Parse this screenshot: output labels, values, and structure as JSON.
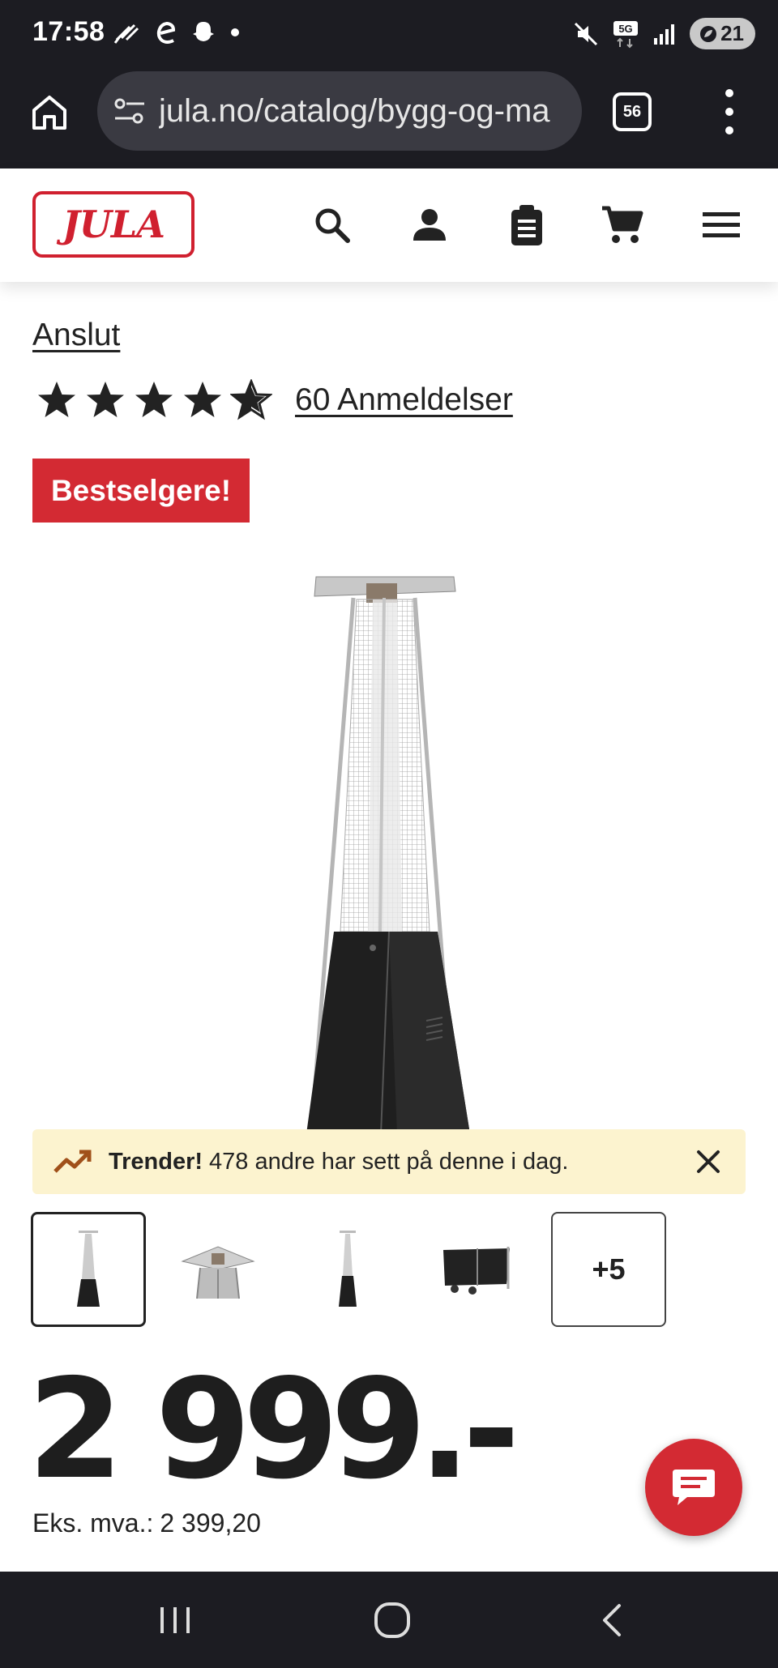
{
  "status_bar": {
    "time": "17:58",
    "left_icons": [
      "feather-icon",
      "e-icon",
      "snapchat-ghost-icon",
      "dot-icon"
    ],
    "network": "5G",
    "battery": "21",
    "right_icons": [
      "mute-icon",
      "5g-icon",
      "signal-icon",
      "battery-icon"
    ]
  },
  "browser": {
    "url": "jula.no/catalog/bygg-og-ma",
    "tab_count": "56",
    "icons": [
      "home-icon",
      "tune-icon",
      "tabs-icon",
      "more-vert-icon"
    ]
  },
  "header": {
    "logo_text": "JULA",
    "icons": [
      "search-icon",
      "account-icon",
      "clipboard-icon",
      "cart-icon",
      "hamburger-menu-icon"
    ],
    "colors": {
      "brand_red": "#d0202f"
    }
  },
  "product": {
    "title": "Anslut",
    "rating": 4.5,
    "reviews_label": "60 Anmeldelser",
    "badge": "Bestselgere!",
    "colors": {
      "badge_bg": "#d32a33",
      "trend_bg": "#fcf3cf"
    }
  },
  "trend": {
    "strong": "Trender!",
    "text": "478 andre har sett på denne i dag."
  },
  "thumbnails": {
    "items": [
      "thumb-heater-full",
      "thumb-heater-top",
      "thumb-heater-small",
      "thumb-heater-base"
    ],
    "more_label": "+5"
  },
  "price": {
    "value": "2 999.-",
    "ex_vat_label": "Eks. mva.:",
    "ex_vat_value": "2 399,20"
  },
  "nav": {
    "icons": [
      "recent-apps-icon",
      "home-circle-icon",
      "back-icon"
    ]
  }
}
